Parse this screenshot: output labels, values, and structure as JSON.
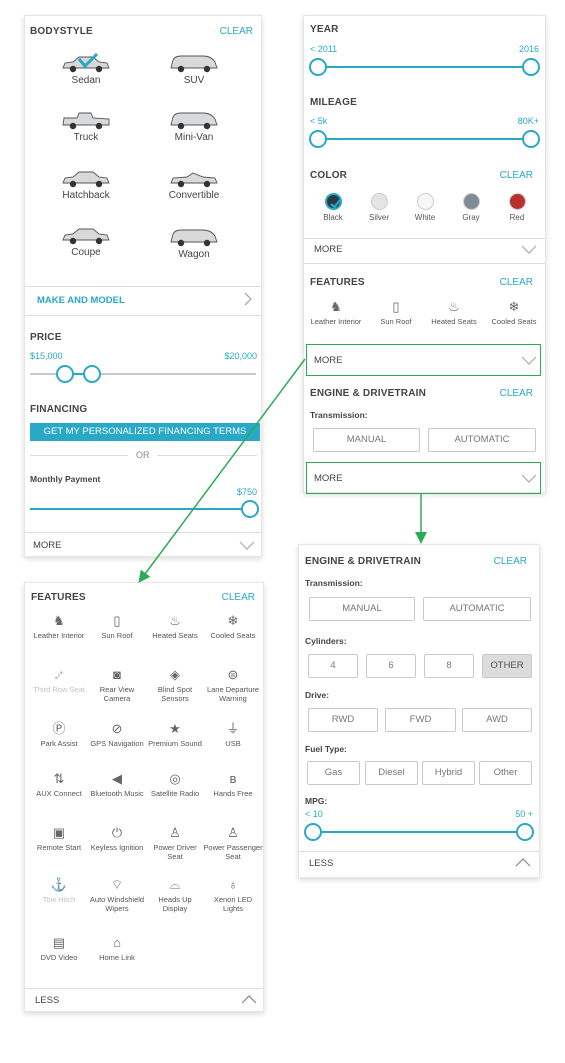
{
  "panel_filters": {
    "bodystyle_title": "BODYSTYLE",
    "clear": "CLEAR",
    "bodystyles": [
      "Sedan",
      "SUV",
      "Truck",
      "Mini-Van",
      "Hatchback",
      "Convertible",
      "Coupe",
      "Wagon"
    ],
    "make_model": "MAKE AND MODEL",
    "price_title": "PRICE",
    "price_min": "$15,000",
    "price_max": "$20,000",
    "financing_title": "FINANCING",
    "financing_cta": "GET MY PERSONALIZED FINANCING TERMS",
    "or": "OR",
    "monthly_payment": "Monthly Payment",
    "monthly_value": "$750",
    "more": "MORE"
  },
  "panel_right": {
    "year_title": "YEAR",
    "year_min": "< 2011",
    "year_max": "2016",
    "mileage_title": "MILEAGE",
    "mileage_min": "< 5k",
    "mileage_max": "80K+",
    "color_title": "COLOR",
    "clear": "CLEAR",
    "colors": [
      {
        "label": "Black",
        "hex": "#2b3a45"
      },
      {
        "label": "Silver",
        "hex": "#e4e4e4"
      },
      {
        "label": "White",
        "hex": "#f7f7f7"
      },
      {
        "label": "Gray",
        "hex": "#7f8c95"
      },
      {
        "label": "Red",
        "hex": "#b8312f"
      }
    ],
    "more": "MORE",
    "features_title": "FEATURES",
    "features": [
      "Leather Interior",
      "Sun Roof",
      "Heated Seats",
      "Cooled Seats"
    ],
    "engine_title": "ENGINE & DRIVETRAIN",
    "transmission_label": "Transmission:",
    "manual": "MANUAL",
    "automatic": "AUTOMATIC"
  },
  "panel_features": {
    "title": "FEATURES",
    "clear": "CLEAR",
    "items": [
      {
        "label": "Leather Interior",
        "icon": "leather-icon",
        "glyph": "♞",
        "disabled": false
      },
      {
        "label": "Sun Roof",
        "icon": "sunroof-icon",
        "glyph": "▯",
        "disabled": false
      },
      {
        "label": "Heated Seats",
        "icon": "heated-seat-icon",
        "glyph": "♨",
        "disabled": false
      },
      {
        "label": "Cooled Seats",
        "icon": "cooled-seat-icon",
        "glyph": "❄",
        "disabled": false
      },
      {
        "label": "Third Row Seat",
        "icon": "third-row-icon",
        "glyph": "⑇",
        "disabled": true
      },
      {
        "label": "Rear View Camera",
        "icon": "camera-icon",
        "glyph": "◙",
        "disabled": false
      },
      {
        "label": "Blind Spot Sensors",
        "icon": "blind-spot-icon",
        "glyph": "◈",
        "disabled": false
      },
      {
        "label": "Lane Departure Warning",
        "icon": "lane-icon",
        "glyph": "⊜",
        "disabled": false
      },
      {
        "label": "Park Assist",
        "icon": "park-assist-icon",
        "glyph": "Ⓟ",
        "disabled": false
      },
      {
        "label": "GPS Navigation",
        "icon": "compass-icon",
        "glyph": "⊘",
        "disabled": false
      },
      {
        "label": "Premium Sound",
        "icon": "star-icon",
        "glyph": "★",
        "disabled": false
      },
      {
        "label": "USB",
        "icon": "usb-icon",
        "glyph": "⏚",
        "disabled": false
      },
      {
        "label": "AUX Connect",
        "icon": "aux-icon",
        "glyph": "⇅",
        "disabled": false
      },
      {
        "label": "Bluetooth Music",
        "icon": "bluetooth-speaker-icon",
        "glyph": "◀",
        "disabled": false
      },
      {
        "label": "Satellite Radio",
        "icon": "satellite-icon",
        "glyph": "◎",
        "disabled": false
      },
      {
        "label": "Hands Free",
        "icon": "bluetooth-icon",
        "glyph": "ʙ",
        "disabled": false
      },
      {
        "label": "Remote Start",
        "icon": "remote-icon",
        "glyph": "▣",
        "disabled": false
      },
      {
        "label": "Keyless Ignition",
        "icon": "power-icon",
        "glyph": "⏻",
        "disabled": false
      },
      {
        "label": "Power Driver Seat",
        "icon": "power-seat-icon",
        "glyph": "♙",
        "disabled": false
      },
      {
        "label": "Power Passenger Seat",
        "icon": "passenger-seat-icon",
        "glyph": "♙",
        "disabled": false
      },
      {
        "label": "Tow Hitch",
        "icon": "tow-hitch-icon",
        "glyph": "⚓",
        "disabled": true
      },
      {
        "label": "Auto Windshield Wipers",
        "icon": "wiper-icon",
        "glyph": "⌔",
        "disabled": false
      },
      {
        "label": "Heads Up Display",
        "icon": "hud-icon",
        "glyph": "⌓",
        "disabled": false
      },
      {
        "label": "Xenon LED Lights",
        "icon": "bulb-icon",
        "glyph": "♁",
        "disabled": false
      },
      {
        "label": "DVD Video",
        "icon": "film-icon",
        "glyph": "▤",
        "disabled": false
      },
      {
        "label": "Home Link",
        "icon": "home-icon",
        "glyph": "⌂",
        "disabled": false
      }
    ],
    "less": "LESS"
  },
  "panel_engine": {
    "title": "ENGINE & DRIVETRAIN",
    "clear": "CLEAR",
    "transmission_label": "Transmission:",
    "transmission": [
      "MANUAL",
      "AUTOMATIC"
    ],
    "cylinders_label": "Cylinders:",
    "cylinders": [
      "4",
      "6",
      "8",
      "OTHER"
    ],
    "drive_label": "Drive:",
    "drive": [
      "RWD",
      "FWD",
      "AWD"
    ],
    "fuel_label": "Fuel Type:",
    "fuel": [
      "Gas",
      "Diesel",
      "Hybrid",
      "Other"
    ],
    "mpg_label": "MPG:",
    "mpg_min": "< 10",
    "mpg_max": "50 +",
    "less": "LESS"
  },
  "colors": {
    "accent": "#29a8c7",
    "flow_arrow": "#2daa57"
  }
}
